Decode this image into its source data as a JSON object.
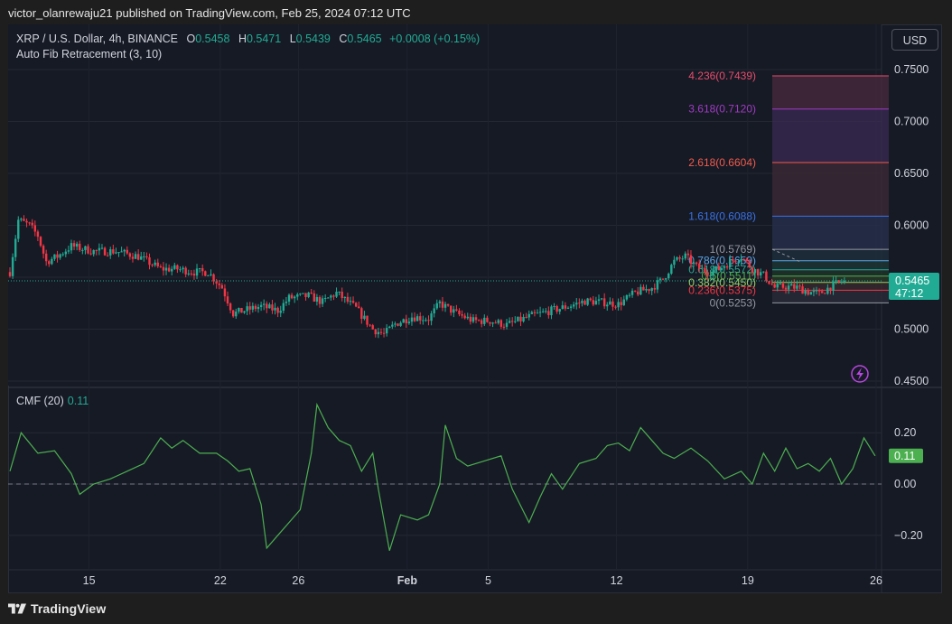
{
  "header": {
    "published": "victor_olanrewaju21 published on TradingView.com, Feb 25, 2024 07:12 UTC"
  },
  "legend": {
    "symbol": "XRP / U.S. Dollar, 4h, BINANCE",
    "o_label": "O",
    "o": "0.5458",
    "h_label": "H",
    "h": "0.5471",
    "l_label": "L",
    "l": "0.5439",
    "c_label": "C",
    "c": "0.5465",
    "change": "+0.0008 (+0.15%)",
    "indicator": "Auto Fib Retracement (3, 10)",
    "cmf_label": "CMF (20)",
    "cmf_value": "0.11"
  },
  "currency_button": "USD",
  "footer": {
    "brand": "TradingView"
  },
  "colors": {
    "up": "#22ab94",
    "down": "#f23645",
    "cmf_line": "#4caf50",
    "background": "#161a25"
  },
  "chart_data": [
    {
      "type": "candlestick",
      "x_ticks": [
        "15",
        "22",
        "26",
        "Feb",
        "5",
        "12",
        "19",
        "26"
      ],
      "y_ticks": [
        "0.7500",
        "0.7000",
        "0.6500",
        "0.6000",
        "0.5500",
        "0.5000",
        "0.4500"
      ],
      "ylim": [
        0.45,
        0.77
      ],
      "last_price": "0.5465",
      "countdown": "47:12",
      "price_anchors": [
        [
          0,
          0.555
        ],
        [
          3,
          0.605
        ],
        [
          7,
          0.6
        ],
        [
          10,
          0.59
        ],
        [
          13,
          0.565
        ],
        [
          17,
          0.57
        ],
        [
          22,
          0.58
        ],
        [
          30,
          0.575
        ],
        [
          38,
          0.575
        ],
        [
          46,
          0.57
        ],
        [
          54,
          0.558
        ],
        [
          60,
          0.558
        ],
        [
          66,
          0.555
        ],
        [
          71,
          0.555
        ],
        [
          76,
          0.54
        ],
        [
          80,
          0.515
        ],
        [
          84,
          0.518
        ],
        [
          90,
          0.522
        ],
        [
          96,
          0.518
        ],
        [
          100,
          0.53
        ],
        [
          107,
          0.532
        ],
        [
          112,
          0.526
        ],
        [
          117,
          0.535
        ],
        [
          124,
          0.52
        ],
        [
          130,
          0.5
        ],
        [
          134,
          0.495
        ],
        [
          138,
          0.505
        ],
        [
          144,
          0.512
        ],
        [
          150,
          0.51
        ],
        [
          154,
          0.525
        ],
        [
          160,
          0.515
        ],
        [
          166,
          0.508
        ],
        [
          172,
          0.508
        ],
        [
          178,
          0.504
        ],
        [
          186,
          0.512
        ],
        [
          194,
          0.518
        ],
        [
          200,
          0.522
        ],
        [
          206,
          0.527
        ],
        [
          212,
          0.526
        ],
        [
          218,
          0.524
        ],
        [
          224,
          0.535
        ],
        [
          230,
          0.54
        ],
        [
          234,
          0.548
        ],
        [
          238,
          0.565
        ],
        [
          242,
          0.57
        ],
        [
          246,
          0.56
        ],
        [
          250,
          0.555
        ],
        [
          254,
          0.558
        ],
        [
          258,
          0.565
        ],
        [
          262,
          0.57
        ],
        [
          266,
          0.558
        ],
        [
          270,
          0.552
        ],
        [
          274,
          0.54
        ],
        [
          278,
          0.541
        ],
        [
          282,
          0.54
        ],
        [
          286,
          0.536
        ],
        [
          290,
          0.534
        ],
        [
          294,
          0.541
        ],
        [
          298,
          0.546
        ]
      ],
      "fib_levels": [
        {
          "label": "4.236(0.7439)",
          "value": 0.7439,
          "color": "#e84c6c"
        },
        {
          "label": "3.618(0.7120)",
          "value": 0.712,
          "color": "#a03bc4"
        },
        {
          "label": "2.618(0.6604)",
          "value": 0.6604,
          "color": "#f15b4d"
        },
        {
          "label": "1.618(0.6088)",
          "value": 0.6088,
          "color": "#3a72e6"
        },
        {
          "label": "1(0.5769)",
          "value": 0.5769,
          "color": "#9598a1"
        },
        {
          "label": "0.786(0.5659)",
          "value": 0.5659,
          "color": "#5ba5e6"
        },
        {
          "label": "0.618(0.5572)",
          "value": 0.5572,
          "color": "#2aa694"
        },
        {
          "label": "0.5(0.5511)",
          "value": 0.5511,
          "color": "#4caf50"
        },
        {
          "label": "0.382(0.5450)",
          "value": 0.545,
          "color": "#9ccc65"
        },
        {
          "label": "0.236(0.5375)",
          "value": 0.5375,
          "color": "#f23645"
        },
        {
          "label": "0(0.5253)",
          "value": 0.5253,
          "color": "#9598a1"
        }
      ]
    },
    {
      "type": "line",
      "name": "CMF (20)",
      "y_ticks": [
        "0.20",
        "0.00",
        "−0.20"
      ],
      "ylim": [
        -0.29,
        0.37
      ],
      "last_value": "0.11",
      "points": [
        [
          0,
          0.05
        ],
        [
          4,
          0.2
        ],
        [
          10,
          0.12
        ],
        [
          16,
          0.13
        ],
        [
          22,
          0.04
        ],
        [
          25,
          -0.04
        ],
        [
          30,
          0.0
        ],
        [
          36,
          0.02
        ],
        [
          42,
          0.05
        ],
        [
          48,
          0.08
        ],
        [
          54,
          0.18
        ],
        [
          58,
          0.14
        ],
        [
          62,
          0.17
        ],
        [
          68,
          0.12
        ],
        [
          74,
          0.12
        ],
        [
          78,
          0.09
        ],
        [
          82,
          0.05
        ],
        [
          86,
          0.06
        ],
        [
          90,
          -0.08
        ],
        [
          92,
          -0.25
        ],
        [
          96,
          -0.2
        ],
        [
          100,
          -0.15
        ],
        [
          104,
          -0.1
        ],
        [
          108,
          0.12
        ],
        [
          110,
          0.31
        ],
        [
          114,
          0.22
        ],
        [
          118,
          0.17
        ],
        [
          122,
          0.15
        ],
        [
          126,
          0.05
        ],
        [
          130,
          0.12
        ],
        [
          132,
          -0.02
        ],
        [
          136,
          -0.26
        ],
        [
          140,
          -0.12
        ],
        [
          146,
          -0.14
        ],
        [
          150,
          -0.12
        ],
        [
          154,
          0.0
        ],
        [
          156,
          0.23
        ],
        [
          160,
          0.1
        ],
        [
          164,
          0.07
        ],
        [
          170,
          0.09
        ],
        [
          176,
          0.11
        ],
        [
          180,
          -0.02
        ],
        [
          186,
          -0.15
        ],
        [
          190,
          -0.05
        ],
        [
          194,
          0.04
        ],
        [
          198,
          -0.02
        ],
        [
          204,
          0.08
        ],
        [
          210,
          0.1
        ],
        [
          214,
          0.15
        ],
        [
          218,
          0.16
        ],
        [
          222,
          0.13
        ],
        [
          226,
          0.22
        ],
        [
          230,
          0.17
        ],
        [
          234,
          0.12
        ],
        [
          238,
          0.1
        ],
        [
          244,
          0.14
        ],
        [
          250,
          0.09
        ],
        [
          256,
          0.02
        ],
        [
          262,
          0.05
        ],
        [
          266,
          0.0
        ],
        [
          270,
          0.12
        ],
        [
          274,
          0.05
        ],
        [
          278,
          0.14
        ],
        [
          282,
          0.06
        ],
        [
          286,
          0.08
        ],
        [
          290,
          0.05
        ],
        [
          294,
          0.1
        ],
        [
          298,
          0.0
        ],
        [
          302,
          0.06
        ],
        [
          306,
          0.18
        ],
        [
          310,
          0.11
        ]
      ]
    }
  ]
}
